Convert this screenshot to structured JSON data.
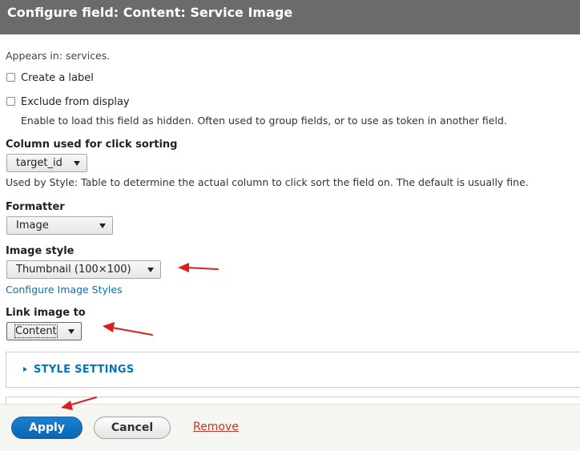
{
  "dialog": {
    "title": "Configure field: Content: Service Image"
  },
  "appears_in": "Appears in: services.",
  "create_label": {
    "label": "Create a label",
    "checked": false
  },
  "exclude_display": {
    "label": "Exclude from display",
    "checked": false,
    "description": "Enable to load this field as hidden. Often used to group fields, or to use as token in another field."
  },
  "click_sort": {
    "label": "Column used for click sorting",
    "value": "target_id",
    "description": "Used by Style: Table to determine the actual column to click sort the field on. The default is usually fine."
  },
  "formatter": {
    "label": "Formatter",
    "value": "Image"
  },
  "image_style": {
    "label": "Image style",
    "value": "Thumbnail (100×100)",
    "configure_link": "Configure Image Styles"
  },
  "link_image": {
    "label": "Link image to",
    "value": "Content"
  },
  "style_settings": {
    "summary": "STYLE SETTINGS"
  },
  "footer": {
    "apply": "Apply",
    "cancel": "Cancel",
    "remove": "Remove"
  },
  "colors": {
    "title_bar": "#6b6b6b",
    "link": "#0074bd",
    "apply_button": "#0a66b2",
    "remove_link": "#c0392b",
    "annotation_arrow": "#d9201f"
  }
}
